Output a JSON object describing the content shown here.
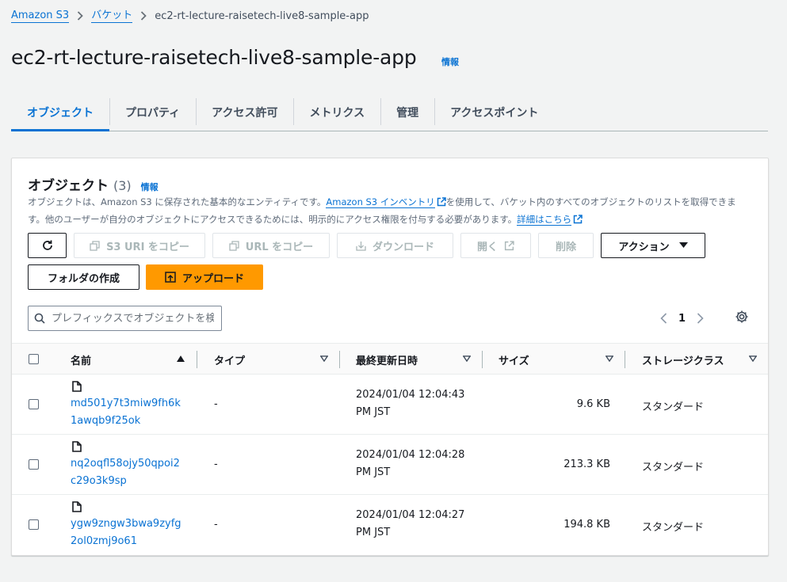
{
  "breadcrumb": {
    "items": [
      "Amazon S3",
      "バケット"
    ],
    "current": "ec2-rt-lecture-raisetech-live8-sample-app"
  },
  "page": {
    "title": "ec2-rt-lecture-raisetech-live8-sample-app",
    "info": "情報"
  },
  "tabs": [
    "オブジェクト",
    "プロパティ",
    "アクセス許可",
    "メトリクス",
    "管理",
    "アクセスポイント"
  ],
  "objects_panel": {
    "title": "オブジェクト",
    "count": "(3)",
    "info": "情報",
    "desc_part1": "オブジェクトは、Amazon S3 に保存された基本的なエンティティです。",
    "desc_link1": "Amazon S3 インベントリ",
    "desc_part2": "を使用して、バケット内のすべてのオブジェクトのリストを取得できます。他のユーザーが自分のオブジェクトにアクセスできるためには、明示的にアクセス権限を付与する必要があります。",
    "desc_link2": "詳細はこちら"
  },
  "toolbar": {
    "copy_s3_uri": "S3 URI をコピー",
    "copy_url": "URL をコピー",
    "download": "ダウンロード",
    "open": "開く",
    "delete": "削除",
    "actions": "アクション",
    "create_folder": "フォルダの作成",
    "upload": "アップロード"
  },
  "search": {
    "placeholder": "プレフィックスでオブジェクトを検索"
  },
  "pagination": {
    "page": "1"
  },
  "table": {
    "columns": [
      "名前",
      "タイプ",
      "最終更新日時",
      "サイズ",
      "ストレージクラス"
    ],
    "rows": [
      {
        "name_line1": "md501y7t3miw9fh6k",
        "name_line2": "1awqb9f25ok",
        "type": "-",
        "date_line1": "2024/01/04 12:04:43",
        "date_line2": "PM JST",
        "size": "9.6 KB",
        "storage_class": "スタンダード"
      },
      {
        "name_line1": "nq2oqfl58ojy50qpoi2",
        "name_line2": "c29o3k9sp",
        "type": "-",
        "date_line1": "2024/01/04 12:04:28",
        "date_line2": "PM JST",
        "size": "213.3 KB",
        "storage_class": "スタンダード"
      },
      {
        "name_line1": "ygw9zngw3bwa9zyfg",
        "name_line2": "2ol0zmj9o61",
        "type": "-",
        "date_line1": "2024/01/04 12:04:27",
        "date_line2": "PM JST",
        "size": "194.8 KB",
        "storage_class": "スタンダード"
      }
    ]
  },
  "colors": {
    "link": "#0972d3",
    "primary_button": "#ff9900",
    "background": "#f2f3f3"
  }
}
